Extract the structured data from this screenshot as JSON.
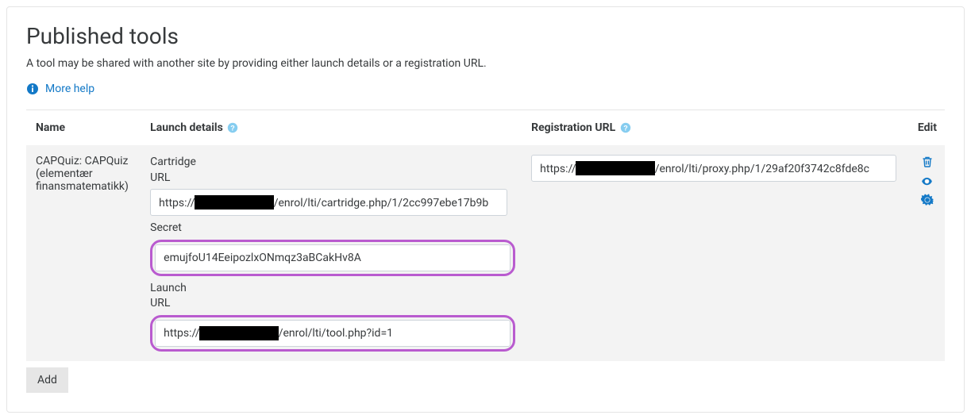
{
  "page": {
    "title": "Published tools",
    "description": "A tool may be shared with another site by providing either launch details or a registration URL.",
    "more_help": "More help"
  },
  "table": {
    "headers": {
      "name": "Name",
      "launch": "Launch details",
      "registration": "Registration URL",
      "edit": "Edit"
    }
  },
  "row": {
    "name": "CAPQuiz: CAPQuiz (elementær finansmatematikk)",
    "cartridge_label": "Cartridge URL",
    "cartridge_value": "https://██████████/enrol/lti/cartridge.php/1/2cc997ebe17b9b",
    "secret_label": "Secret",
    "secret_value": "emujfoU14EeipozlxONmqz3aBCakHv8A",
    "launch_label": "Launch URL",
    "launch_value": "https://██████████/enrol/lti/tool.php?id=1",
    "registration_value": "https://██████████/enrol/lti/proxy.php/1/29af20f3742c8fde8c"
  },
  "actions": {
    "add": "Add"
  },
  "icons": {
    "info": "info-circle-icon",
    "help": "help-icon",
    "trash": "trash-icon",
    "eye": "eye-icon",
    "gear": "gear-icon"
  },
  "colors": {
    "link": "#1379c7",
    "highlight": "#b95bcf"
  }
}
